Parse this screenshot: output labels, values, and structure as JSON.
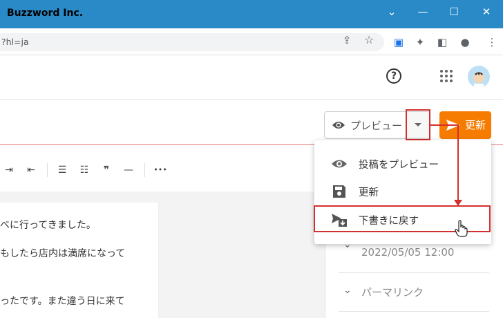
{
  "window": {
    "title": "Buzzword Inc."
  },
  "address": {
    "url": "?hl=ja"
  },
  "header": {
    "help_label": "?"
  },
  "actions": {
    "preview_label": "プレビュー",
    "update_label": "更新"
  },
  "toolbar": {
    "quote_label": "❞",
    "more_label": "•••"
  },
  "editor": {
    "lines": [
      "べに行ってきました。",
      "もしたら店内は満席になって",
      "ったです。また違う日に来て"
    ]
  },
  "dropdown": {
    "items": [
      {
        "label": "投稿をプレビュー",
        "icon": "eye-icon"
      },
      {
        "label": "更新",
        "icon": "save-icon"
      },
      {
        "label": "下書きに戻す",
        "icon": "revert-draft-icon"
      }
    ]
  },
  "sidebar": {
    "date": "2022/05/05 12:00",
    "permalink_label": "パーマリンク"
  },
  "colors": {
    "titlebar": "#2a8ac8",
    "accent": "#f57c00",
    "highlight": "#d32f2f"
  }
}
